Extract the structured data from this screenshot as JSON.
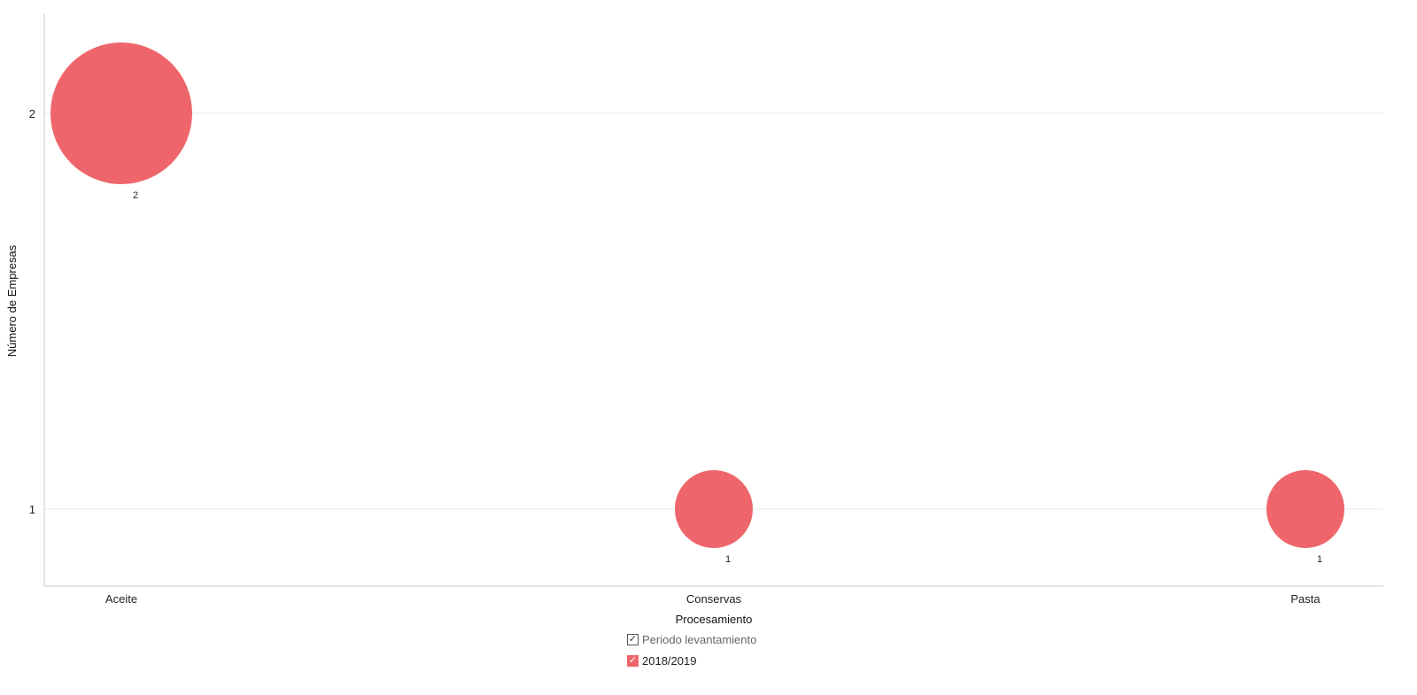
{
  "chart_data": {
    "type": "scatter",
    "categories": [
      "Aceite",
      "Conservas",
      "Pasta"
    ],
    "series": [
      {
        "name": "2018/2019",
        "values": [
          2,
          1,
          1
        ],
        "labels": [
          "2",
          "1",
          "1"
        ]
      }
    ],
    "xlabel": "Procesamiento",
    "ylabel": "Número de Empresas",
    "yticks": [
      "2",
      "1"
    ],
    "ytick_values": [
      2,
      1
    ],
    "grid": true,
    "bubble_size_by_value": true,
    "legend": {
      "title": "Periodo levantamiento",
      "placement": "bottom-center"
    },
    "colors": {
      "series": "#ee666b",
      "grid": "#e8e8e8",
      "axis": "#c8c8c8"
    }
  },
  "legend": {
    "header_check": "✓",
    "series_check": "✓"
  }
}
